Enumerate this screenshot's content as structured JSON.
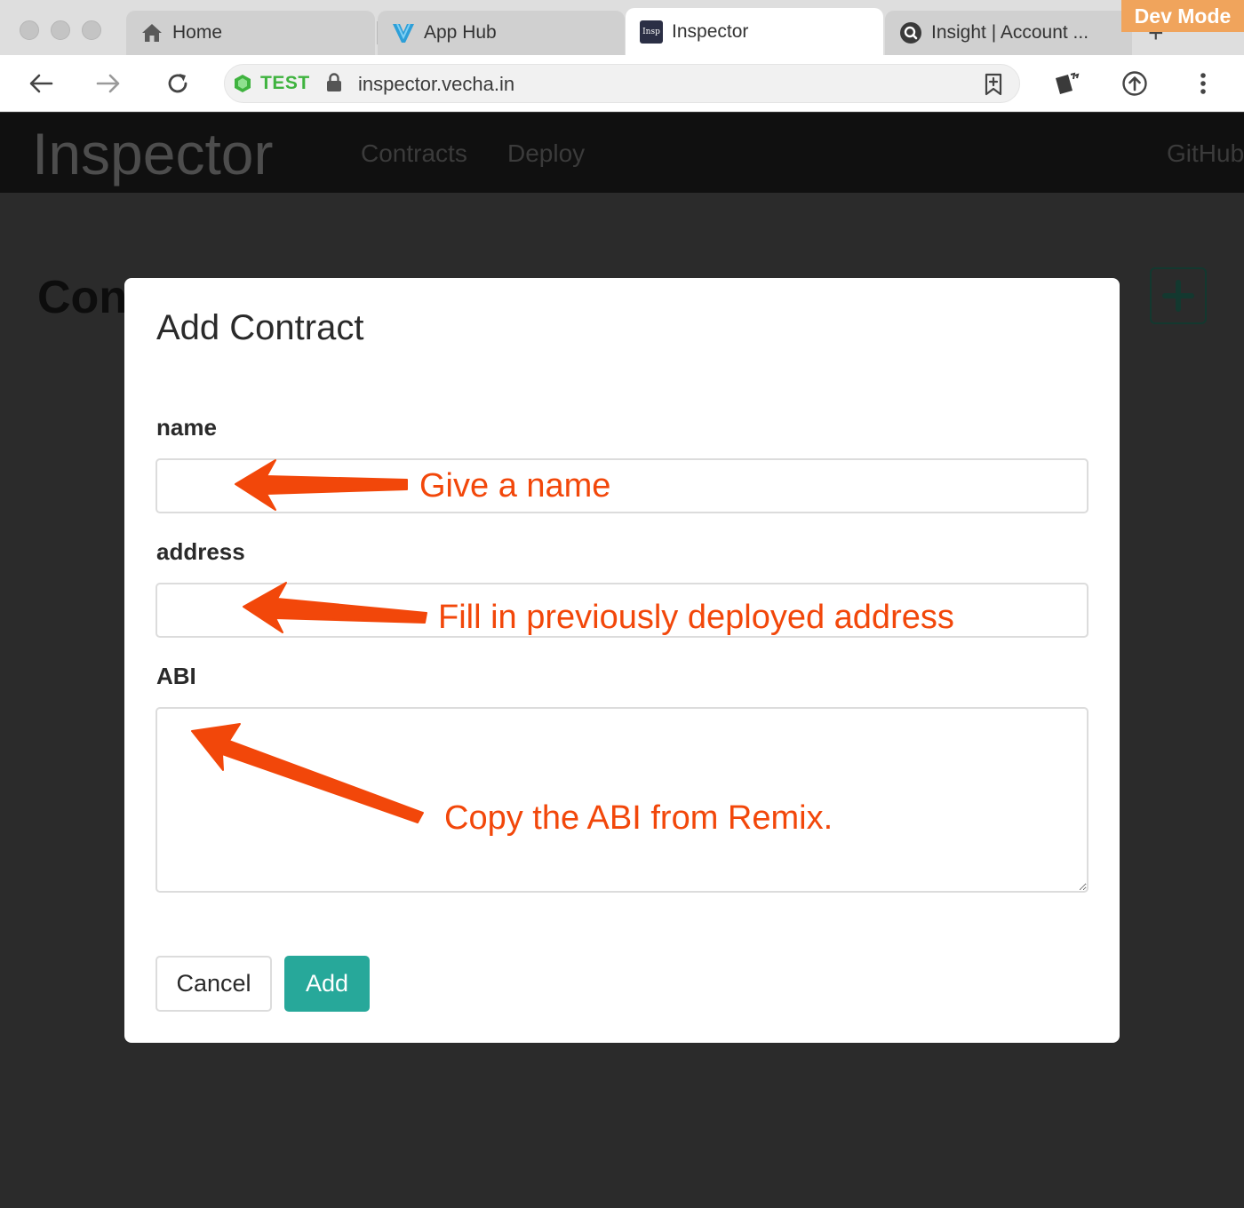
{
  "browser": {
    "tabs": [
      {
        "label": "Home",
        "icon": "home-icon"
      },
      {
        "label": "App Hub",
        "icon": "vechain-icon"
      },
      {
        "label": "Inspector",
        "icon": "inspector-favicon",
        "favicon_text": "Insp"
      },
      {
        "label": "Insight | Account ...",
        "icon": "insight-favicon"
      }
    ],
    "new_tab_label": "+",
    "dev_mode_label": "Dev Mode",
    "network_badge": "TEST",
    "url": "inspector.vecha.in",
    "colors": {
      "test_badge": "#3fb33f",
      "dev_mode": "#f0a45c"
    }
  },
  "app": {
    "brand": "Inspector",
    "nav": {
      "contracts": "Contracts",
      "deploy": "Deploy",
      "github": "GitHub"
    },
    "page_heading": "Con"
  },
  "modal": {
    "title": "Add Contract",
    "fields": {
      "name": {
        "label": "name",
        "value": "",
        "placeholder": ""
      },
      "address": {
        "label": "address",
        "value": "",
        "placeholder": ""
      },
      "abi": {
        "label": "ABI",
        "value": "",
        "placeholder": ""
      }
    },
    "cancel_label": "Cancel",
    "add_label": "Add",
    "colors": {
      "add_button": "#27a89a"
    }
  },
  "annotations": {
    "name_hint": "Give a name",
    "address_hint": "Fill in previously deployed address",
    "abi_hint": "Copy the ABI from Remix.",
    "color": "#f2470a"
  }
}
